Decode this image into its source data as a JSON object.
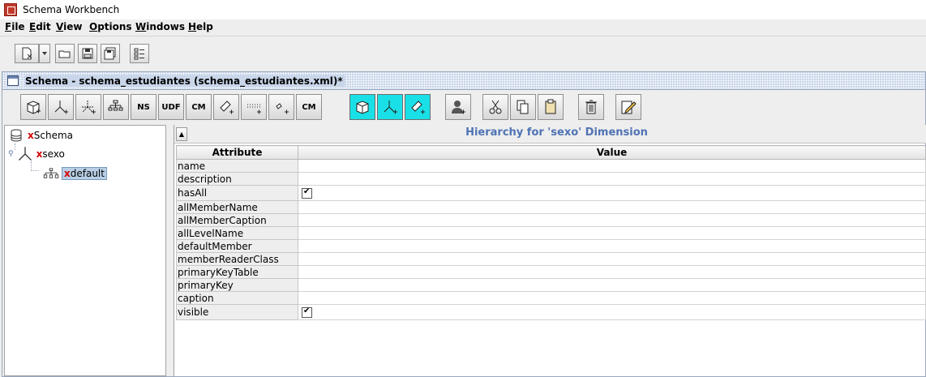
{
  "window": {
    "title": "Schema Workbench",
    "icon": "workbench-icon"
  },
  "menu": [
    "File",
    "Edit",
    "View",
    "Options",
    "Windows",
    "Help"
  ],
  "main_toolbar": [
    "new-file-icon",
    "dropdown-icon",
    "open-folder-icon",
    "save-icon",
    "save-as-icon",
    "jdbc-explorer-icon"
  ],
  "document": {
    "title": "Schema - schema_estudiantes (schema_estudiantes.xml)*",
    "toolbar": [
      {
        "name": "add-cube",
        "label": ""
      },
      {
        "name": "add-dimension",
        "label": ""
      },
      {
        "name": "add-dimension-usage",
        "label": ""
      },
      {
        "name": "add-hierarchy",
        "label": ""
      },
      {
        "name": "add-named-set",
        "label": "NS"
      },
      {
        "name": "add-udf",
        "label": "UDF"
      },
      {
        "name": "add-calculated-member",
        "label": "CM"
      },
      {
        "name": "add-measure",
        "label": ""
      },
      {
        "name": "add-level",
        "label": ""
      },
      {
        "name": "add-property",
        "label": ""
      },
      {
        "name": "add-virtual-calculated-member",
        "label": "CM"
      },
      {
        "name": "add-virtual-cube",
        "label": ""
      },
      {
        "name": "add-virtual-dimension",
        "label": ""
      },
      {
        "name": "add-virtual-measure",
        "label": ""
      },
      {
        "name": "add-role",
        "label": ""
      },
      {
        "name": "cut",
        "label": ""
      },
      {
        "name": "copy",
        "label": ""
      },
      {
        "name": "paste",
        "label": ""
      },
      {
        "name": "delete",
        "label": ""
      },
      {
        "name": "edit-mode",
        "label": ""
      }
    ]
  },
  "tree": {
    "root": {
      "mark": "x",
      "label": "Schema"
    },
    "dimension": {
      "mark": "x",
      "label": "sexo"
    },
    "hierarchy": {
      "mark": "x",
      "label": "default"
    }
  },
  "properties": {
    "title": "Hierarchy for 'sexo' Dimension",
    "columns": {
      "attribute": "Attribute",
      "value": "Value"
    },
    "rows": [
      {
        "attribute": "name",
        "value": ""
      },
      {
        "attribute": "description",
        "value": ""
      },
      {
        "attribute": "hasAll",
        "checked": true
      },
      {
        "attribute": "allMemberName",
        "value": ""
      },
      {
        "attribute": "allMemberCaption",
        "value": ""
      },
      {
        "attribute": "allLevelName",
        "value": ""
      },
      {
        "attribute": "defaultMember",
        "value": ""
      },
      {
        "attribute": "memberReaderClass",
        "value": ""
      },
      {
        "attribute": "primaryKeyTable",
        "value": ""
      },
      {
        "attribute": "primaryKey",
        "value": ""
      },
      {
        "attribute": "caption",
        "value": ""
      },
      {
        "attribute": "visible",
        "checked": true
      }
    ]
  },
  "colors": {
    "accent": "#4f73b4",
    "cyan": "#19e0e6",
    "error_mark": "#d40000"
  }
}
